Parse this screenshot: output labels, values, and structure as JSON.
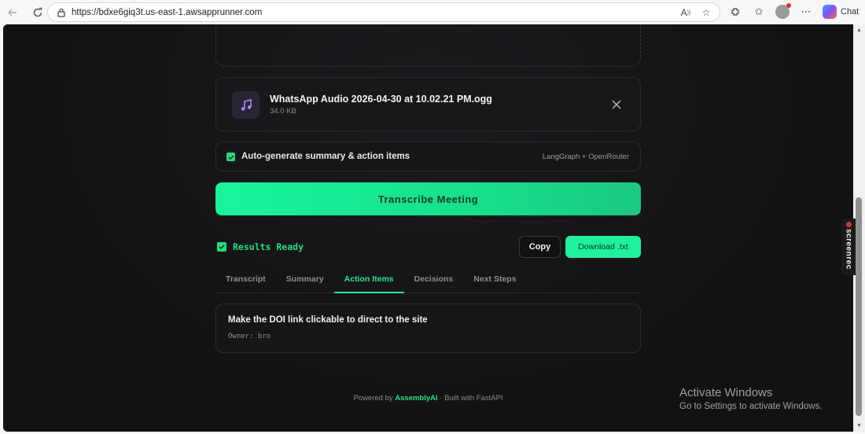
{
  "browser": {
    "url": "https://bdxe6giq3t.us-east-1.awsapprunner.com",
    "chat_label": "Chat"
  },
  "file": {
    "name": "WhatsApp Audio 2026-04-30 at 10.02.21 PM.ogg",
    "size": "34.0 KB"
  },
  "options": {
    "auto_summary_label": "Auto-generate summary & action items",
    "auto_summary_checked": true,
    "engine_label": "LangGraph + OpenRouter"
  },
  "transcribe_button": "Transcribe Meeting",
  "results": {
    "status": "Results Ready",
    "copy_label": "Copy",
    "download_label": "Download .txt"
  },
  "tabs": [
    {
      "label": "Transcript",
      "active": false
    },
    {
      "label": "Summary",
      "active": false
    },
    {
      "label": "Action Items",
      "active": true
    },
    {
      "label": "Decisions",
      "active": false
    },
    {
      "label": "Next Steps",
      "active": false
    }
  ],
  "action_items": [
    {
      "title": "Make the DOI link clickable to direct to the site",
      "owner": "Owner: bro"
    }
  ],
  "footer": {
    "prefix": "Powered by ",
    "brand": "AssemblyAI",
    "suffix": " · Built with FastAPI"
  },
  "overlays": {
    "screenrec": "screenrec",
    "activate_title": "Activate Windows",
    "activate_sub": "Go to Settings to activate Windows."
  },
  "colors": {
    "accent": "#1ee88a",
    "background": "#141414",
    "card": "#161618"
  }
}
